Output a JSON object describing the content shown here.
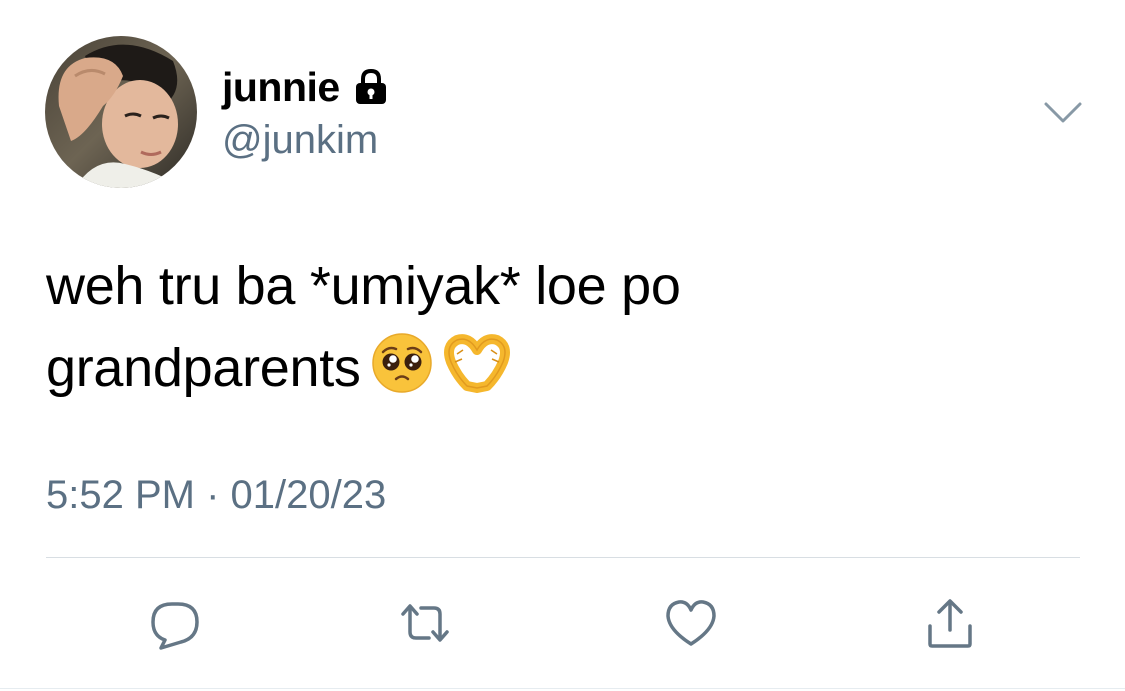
{
  "tweet": {
    "display_name": "junnie",
    "handle": "@junkim",
    "protected_icon": "lock-icon",
    "menu_icon": "chevron-down-icon",
    "text_line1": "weh tru ba *umiyak* loe po",
    "text_line2": "grandparents",
    "emojis": [
      "pleading-face-emoji",
      "heart-hands-emoji"
    ],
    "timestamp": "5:52 PM · 01/20/23"
  },
  "actions": {
    "reply_icon": "reply-icon",
    "retweet_icon": "retweet-icon",
    "like_icon": "heart-icon",
    "share_icon": "share-icon"
  },
  "colors": {
    "text_primary": "#000000",
    "text_secondary": "#5b7083",
    "divider": "#d8dee3",
    "emoji_yellow": "#f9c33b"
  }
}
